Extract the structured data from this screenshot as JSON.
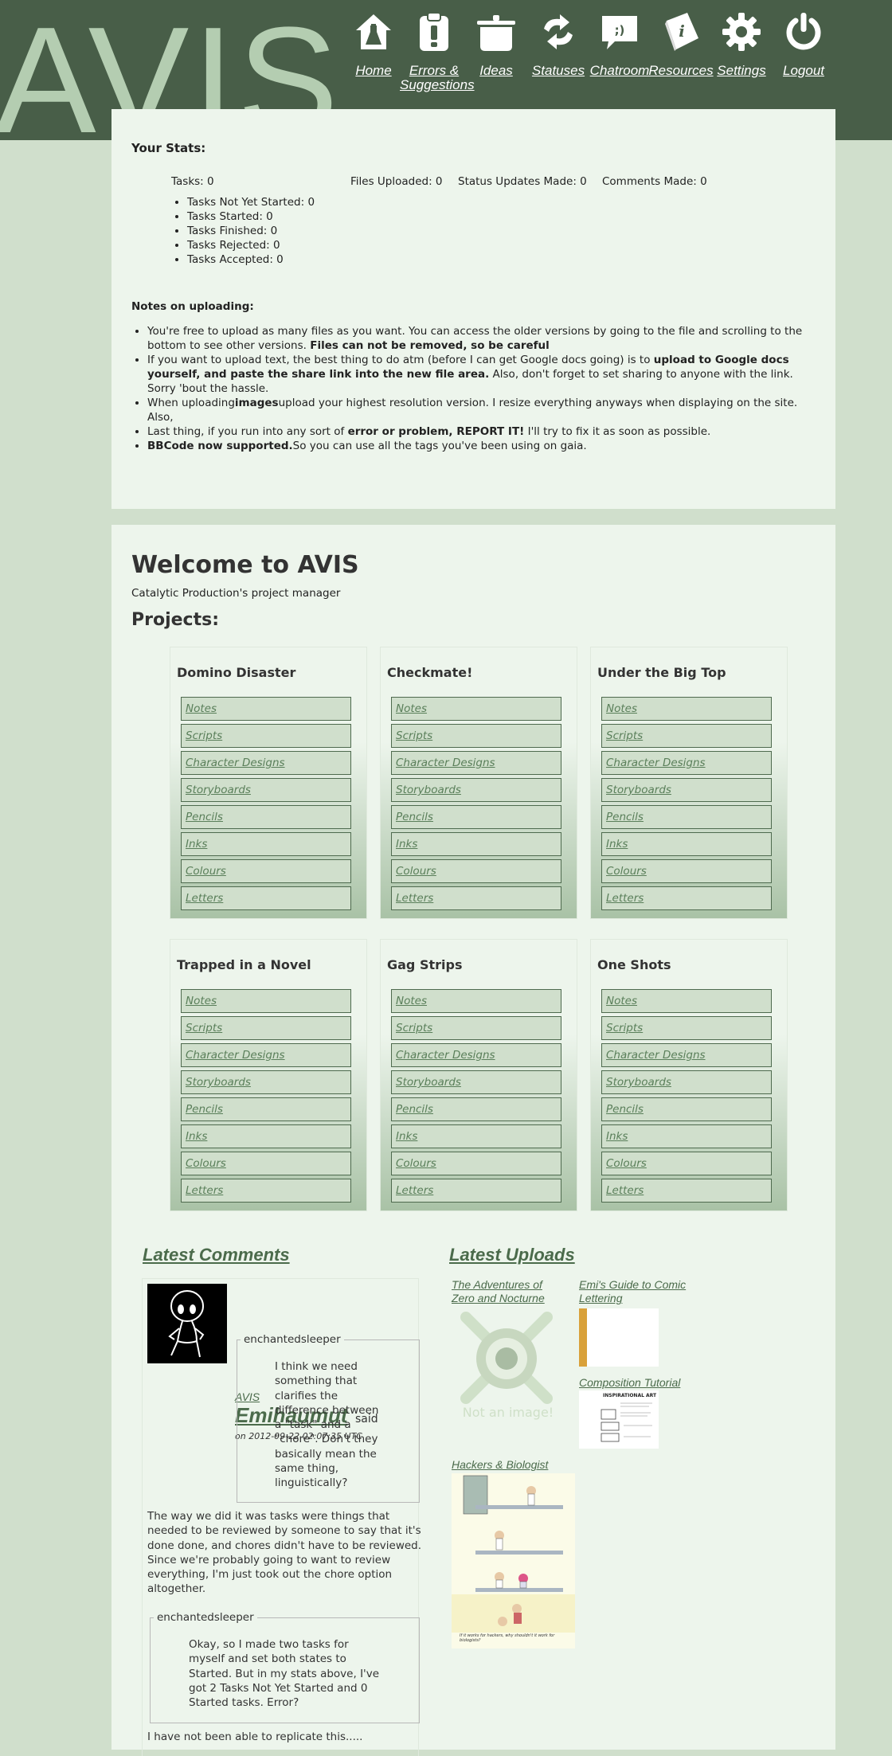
{
  "header": {
    "logo": "AVIS",
    "nav": [
      {
        "label": "Home",
        "icon": "home-icon"
      },
      {
        "label": "Errors & Suggestions",
        "icon": "clipboard-icon"
      },
      {
        "label": "Ideas",
        "icon": "cooking-pot-icon"
      },
      {
        "label": "Statuses",
        "icon": "refresh-icon"
      },
      {
        "label": "Chatroom",
        "icon": "chat-bubble-icon"
      },
      {
        "label": "Resources",
        "icon": "info-book-icon"
      },
      {
        "label": "Settings",
        "icon": "gear-icon"
      },
      {
        "label": "Logout",
        "icon": "power-icon"
      }
    ]
  },
  "stats": {
    "title": "Your Stats:",
    "tasks": "Tasks: 0",
    "files": "Files Uploaded: 0",
    "status": "Status Updates Made: 0",
    "comments": "Comments Made: 0",
    "breakdown": [
      "Tasks Not Yet Started: 0",
      "Tasks Started: 0",
      "Tasks Finished: 0",
      "Tasks Rejected: 0",
      "Tasks Accepted: 0"
    ]
  },
  "notes": {
    "title": "Notes on uploading:",
    "n1a": "You're free to upload as many files as you want. You can access the older versions by going to the file and scrolling to the bottom to see other versions. ",
    "n1b": "Files can not be removed, so be careful",
    "n2a": "If you want to upload text, the best thing to do atm (before I can get Google docs going) is to ",
    "n2b": "upload to Google docs yourself, and paste the share link into the new file area.",
    "n2c": " Also, don't forget to set sharing to anyone with the link. Sorry 'bout the hassle.",
    "n3a": "When uploading",
    "n3b": "images",
    "n3c": "upload your highest resolution version. I resize everything anyways when displaying on the site. Also,",
    "n4a": "Last thing, if you run into any sort of ",
    "n4b": "error or problem, REPORT IT!",
    "n4c": " I'll try to fix it as soon as possible.",
    "n5a": "BBCode now supported.",
    "n5b": "So you can use all the tags you've been using on gaia."
  },
  "welcome": {
    "title": "Welcome to AVIS",
    "tagline": "Catalytic Production's project manager",
    "projects_label": "Projects:"
  },
  "projects": [
    {
      "name": "Domino Disaster"
    },
    {
      "name": "Checkmate!"
    },
    {
      "name": "Under the Big Top"
    },
    {
      "name": "Trapped in a Novel"
    },
    {
      "name": "Gag Strips"
    },
    {
      "name": "One Shots"
    }
  ],
  "project_links": [
    "Notes",
    "Scripts",
    "Character Designs",
    "Storyboards",
    "Pencils",
    "Inks",
    "Colours",
    "Letters"
  ],
  "comments": {
    "title": "Latest Comments",
    "project": "AVIS",
    "user": "Emihaumut",
    "said": "said",
    "date": "on 2012-09-22 02:07:35 UTC",
    "quote1_author": "enchantedsleeper",
    "quote1": [
      "I think we need",
      "something that",
      "clarifies the",
      "difference between",
      "a \"task\" and a",
      "\"chore\". Don't they",
      "basically mean the",
      "same thing,",
      "linguistically?"
    ],
    "reply1": [
      "The way we did it was tasks were things that",
      "needed to be reviewed by someone to say that it's",
      "done done, and chores didn't have to be reviewed.",
      "Since we're probably going to want to review",
      "everything, I'm just took out the chore option",
      "altogether."
    ],
    "quote2_author": "enchantedsleeper",
    "quote2": [
      "Okay, so I made two tasks for",
      "myself and set both states to",
      "Started. But in my stats above, I've",
      "got 2 Tasks Not Yet Started and 0",
      "Started tasks. Error?"
    ],
    "reply2": "I have not been able to replicate this....."
  },
  "uploads": {
    "title": "Latest Uploads",
    "items": [
      {
        "title": "The Adventures of Zero and Nocturne",
        "placeholder": "Not an image!"
      },
      {
        "title": "Emi's Guide to Comic Lettering"
      },
      {
        "title": "Composition Tutorial",
        "thumb_heading": "INSPIRATIONAL ART"
      },
      {
        "title": "Hackers & Biologist",
        "caption": "If it works for hackers, why shouldn't it work for biologists?"
      }
    ]
  },
  "colors": {
    "header_bg": "#485e48",
    "page_bg": "#d0dfcc",
    "panel_bg": "#edf5ec",
    "link": "#4b6b4b",
    "logo": "#b4cdb1"
  }
}
